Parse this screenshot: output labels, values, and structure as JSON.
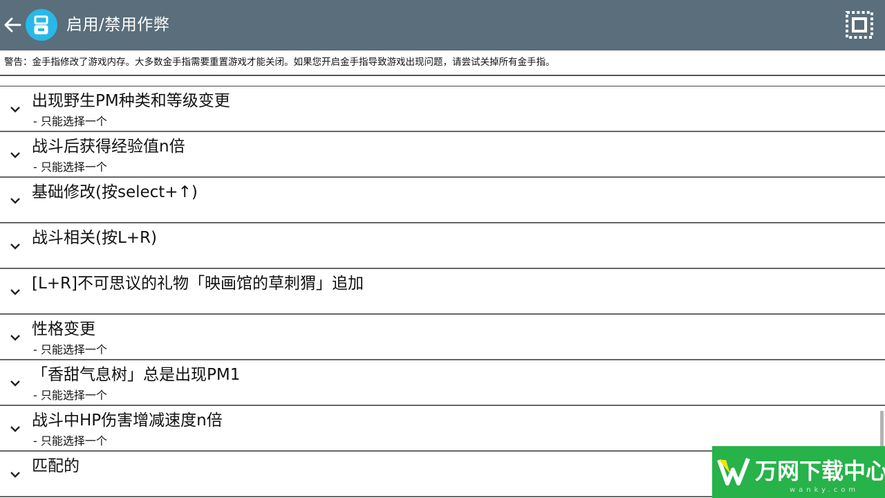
{
  "toolbar": {
    "title": "启用/禁用作弊",
    "back_icon": "arrow-left-icon",
    "app_icon": "ds-emulator-icon",
    "select_all_icon": "select-all-icon",
    "background_color": "#5a6e7b",
    "app_icon_color": "#29b8e8"
  },
  "warning": {
    "text": "警告：金手指修改了游戏内存。大多数金手指需要重置游戏才能关闭。如果您开启金手指导致游戏出现问题，请尝试关掉所有金手指。"
  },
  "cheats": [
    {
      "title": "出现野生PM种类和等级变更",
      "subtitle": "- 只能选择一个"
    },
    {
      "title": "战斗后获得经验值n倍",
      "subtitle": "- 只能选择一个"
    },
    {
      "title": "基础修改(按select+↑)",
      "subtitle": ""
    },
    {
      "title": "战斗相关(按L+R)",
      "subtitle": ""
    },
    {
      "title": "[L+R]不可思议的礼物「映画馆的草刺猬」追加",
      "subtitle": ""
    },
    {
      "title": "性格变更",
      "subtitle": "- 只能选择一个"
    },
    {
      "title": "「香甜气息树」总是出现PM1",
      "subtitle": "- 只能选择一个"
    },
    {
      "title": "战斗中HP伤害增减速度n倍",
      "subtitle": "- 只能选择一个"
    },
    {
      "title": "匹配的",
      "subtitle": ""
    }
  ],
  "watermark": {
    "text": "万网下载中心",
    "sub": "wanky.com",
    "color": "#27b24a"
  }
}
